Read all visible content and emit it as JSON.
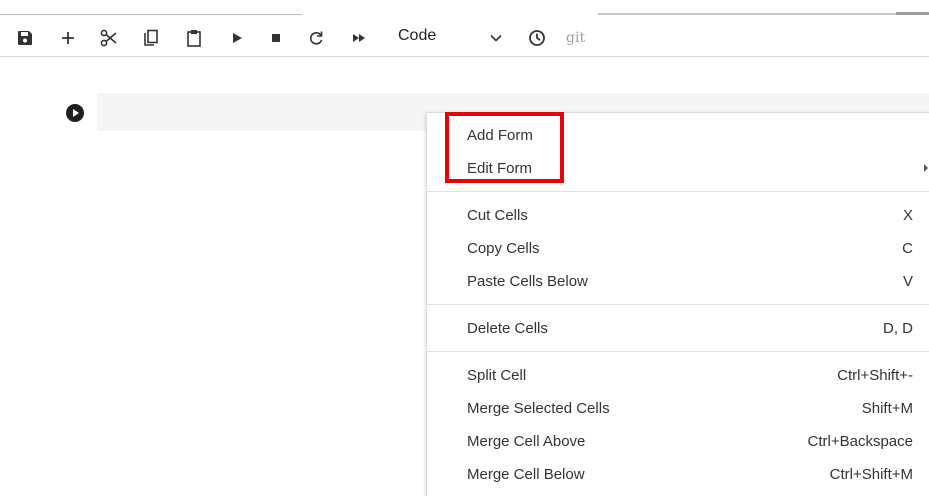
{
  "toolbar": {
    "cell_type": "Code",
    "git_label": "git",
    "buttons": [
      {
        "name": "save-icon",
        "tooltip": "Save"
      },
      {
        "name": "add-cell-icon",
        "tooltip": "Insert cell"
      },
      {
        "name": "cut-icon",
        "tooltip": "Cut"
      },
      {
        "name": "copy-icon",
        "tooltip": "Copy"
      },
      {
        "name": "paste-icon",
        "tooltip": "Paste"
      },
      {
        "name": "run-icon",
        "tooltip": "Run"
      },
      {
        "name": "stop-icon",
        "tooltip": "Interrupt"
      },
      {
        "name": "restart-icon",
        "tooltip": "Restart"
      },
      {
        "name": "fast-forward-icon",
        "tooltip": "Restart and run all"
      }
    ]
  },
  "context_menu": {
    "form_items": [
      {
        "label": "Add Form",
        "shortcut": ""
      },
      {
        "label": "Edit Form",
        "shortcut": "",
        "has_submenu": true
      }
    ],
    "clipboard_items": [
      {
        "label": "Cut Cells",
        "shortcut": "X"
      },
      {
        "label": "Copy Cells",
        "shortcut": "C"
      },
      {
        "label": "Paste Cells Below",
        "shortcut": "V"
      }
    ],
    "delete_items": [
      {
        "label": "Delete Cells",
        "shortcut": "D, D"
      }
    ],
    "cell_items": [
      {
        "label": "Split Cell",
        "shortcut": "Ctrl+Shift+-"
      },
      {
        "label": "Merge Selected Cells",
        "shortcut": "Shift+M"
      },
      {
        "label": "Merge Cell Above",
        "shortcut": "Ctrl+Backspace"
      },
      {
        "label": "Merge Cell Below",
        "shortcut": "Ctrl+Shift+M"
      }
    ]
  },
  "colors": {
    "highlight": "#e8000b",
    "icon": "#333333",
    "cell_background": "#f5f5f5"
  }
}
